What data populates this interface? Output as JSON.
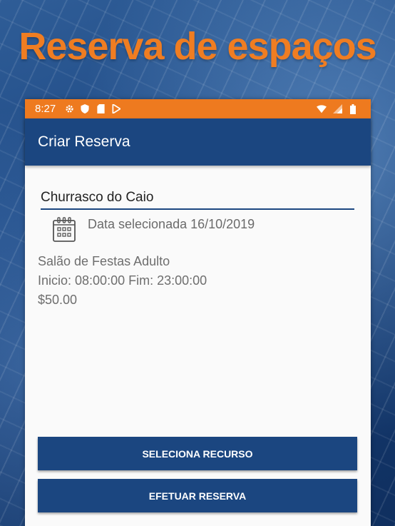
{
  "headline": "Reserva de espaços",
  "colors": {
    "accent": "#ee7a1f",
    "primary": "#1b4680"
  },
  "status_bar": {
    "time": "8:27",
    "icons": [
      "gear-icon",
      "shield-icon",
      "sd-card-icon",
      "play-store-icon",
      "wifi-icon",
      "signal-icon",
      "battery-icon"
    ]
  },
  "app_bar": {
    "title": "Criar Reserva"
  },
  "form": {
    "name_value": "Churrasco do Caio",
    "date_label": "Data selecionada 16/10/2019"
  },
  "resource": {
    "name": "Salão de Festas Adulto",
    "schedule": "Inicio: 08:00:00 Fim: 23:00:00",
    "price": "$50.00"
  },
  "actions": {
    "select_resource": "SELECIONA RECURSO",
    "make_reservation": "EFETUAR RESERVA"
  }
}
